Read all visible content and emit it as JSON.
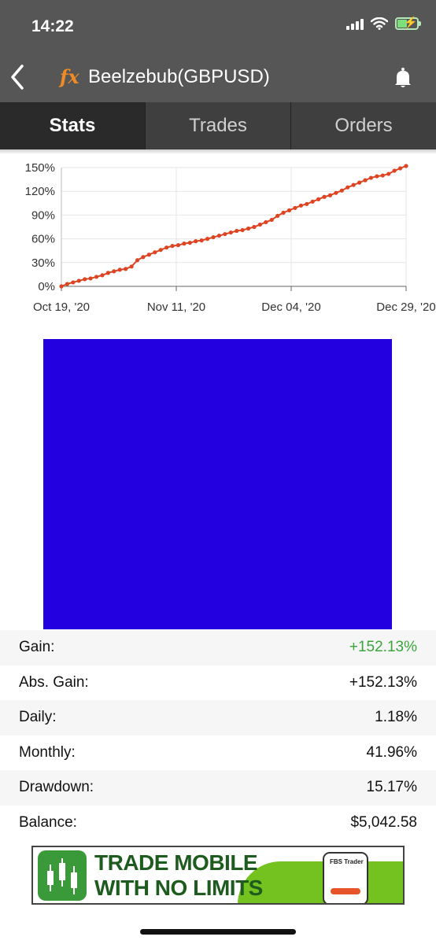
{
  "status_bar": {
    "time": "14:22"
  },
  "header": {
    "logo_text": "fx",
    "title": "Beelzebub(GBPUSD)",
    "icons": [
      "chevron-left-icon",
      "bell-icon"
    ]
  },
  "tabs": [
    {
      "label": "Stats",
      "active": true
    },
    {
      "label": "Trades",
      "active": false
    },
    {
      "label": "Orders",
      "active": false
    }
  ],
  "chart_data": {
    "type": "line",
    "title": "",
    "xlabel": "",
    "ylabel": "",
    "y_ticks": [
      "150%",
      "120%",
      "90%",
      "60%",
      "30%",
      "0%"
    ],
    "x_ticks": [
      "Oct 19, '20",
      "Nov 11, '20",
      "Dec 04, '20",
      "Dec 29, '20"
    ],
    "ylim": [
      0,
      150
    ],
    "grid": true,
    "series": [
      {
        "color": "#dd4422",
        "values": [
          0,
          3,
          5,
          7,
          9,
          10,
          12,
          14,
          17,
          19,
          21,
          22,
          25,
          33,
          37,
          40,
          43,
          46,
          49,
          51,
          52,
          54,
          55,
          57,
          58,
          60,
          62,
          64,
          66,
          68,
          70,
          71,
          73,
          75,
          78,
          81,
          84,
          89,
          93,
          96,
          99,
          102,
          104,
          107,
          110,
          113,
          115,
          118,
          121,
          125,
          128,
          131,
          134,
          137,
          139,
          140,
          142,
          146,
          149,
          152
        ]
      }
    ]
  },
  "stats": [
    {
      "label": "Gain:",
      "value": "+152.13%",
      "positive": true
    },
    {
      "label": "Abs. Gain:",
      "value": "+152.13%",
      "positive": false
    },
    {
      "label": "Daily:",
      "value": "1.18%",
      "positive": false
    },
    {
      "label": "Monthly:",
      "value": "41.96%",
      "positive": false
    },
    {
      "label": "Drawdown:",
      "value": "15.17%",
      "positive": false
    },
    {
      "label": "Balance:",
      "value": "$5,042.58",
      "positive": false
    }
  ],
  "ad": {
    "line1": "TRADE MOBILE",
    "line2": "WITH NO LIMITS",
    "phone_label": "FBS Trader"
  }
}
